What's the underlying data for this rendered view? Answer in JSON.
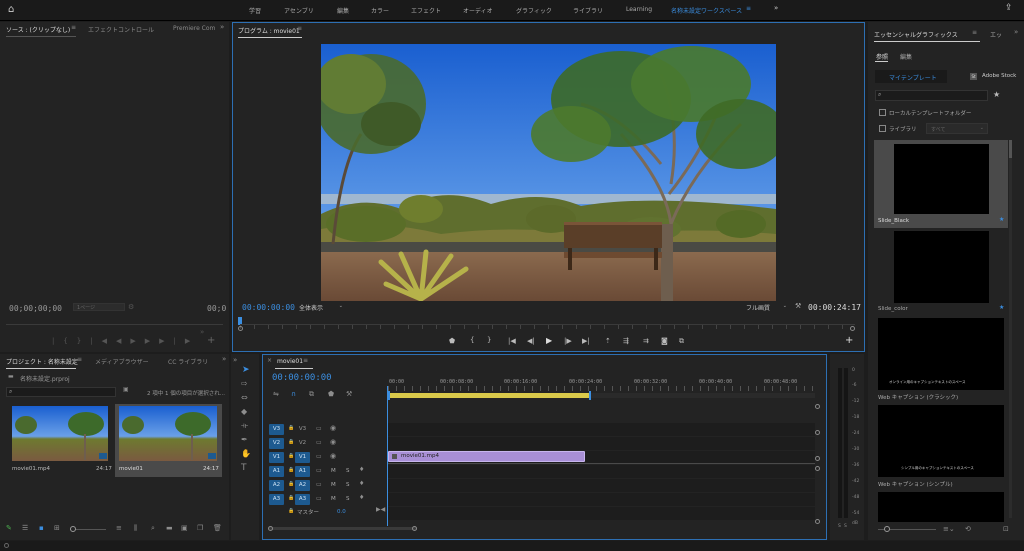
{
  "workspaces": [
    "学習",
    "アセンブリ",
    "編集",
    "カラー",
    "エフェクト",
    "オーディオ",
    "グラフィック",
    "ライブラリ",
    "Learning",
    "名称未設定ワークスペース"
  ],
  "source_panel": {
    "tabs": [
      "ソース : (クリップなし)",
      "エフェクトコントロール",
      "Premiere Com"
    ],
    "timecode_left": "00;00;00;00",
    "page": "1ページ",
    "timecode_right": "00;0"
  },
  "program_panel": {
    "title": "プログラム : movie01",
    "timecode_current": "00:00:00:00",
    "zoom": "全体表示",
    "quality": "フル画質",
    "duration": "00:00:24:17"
  },
  "project_panel": {
    "tabs": [
      "プロジェクト : 名称未設定",
      "メディアブラウザー",
      "CC ライブラリ"
    ],
    "file": "名称未設定.prproj",
    "selection_info": "2 項中 1 個の項目が選択され...",
    "items": [
      {
        "name": "movie01.mp4",
        "duration": "24:17"
      },
      {
        "name": "movie01",
        "duration": "24:17"
      }
    ]
  },
  "timeline": {
    "title": "movie01",
    "timecode": "00:00:00:00",
    "ruler": [
      "00:00",
      "00:00:08:00",
      "00:00:16:00",
      "00:00:24:00",
      "00:00:32:00",
      "00:00:40:00",
      "00:00:48:00"
    ],
    "video_tracks": [
      {
        "src": "V3",
        "name": "V3"
      },
      {
        "src": "V2",
        "name": "V2"
      },
      {
        "src": "V1",
        "name": "V1"
      }
    ],
    "audio_tracks": [
      {
        "src": "A1",
        "name": "A1",
        "m": "M",
        "s": "S"
      },
      {
        "src": "A2",
        "name": "A2",
        "m": "M",
        "s": "S"
      },
      {
        "src": "A3",
        "name": "A3",
        "m": "M",
        "s": "S"
      }
    ],
    "master_label": "マスター",
    "master_value": "0.0",
    "clip_label": "movie01.mp4"
  },
  "meters": [
    "0",
    "-6",
    "-12",
    "-18",
    "-24",
    "-30",
    "-36",
    "-42",
    "-48",
    "-54",
    "dB"
  ],
  "meter_foot": [
    "S",
    "S"
  ],
  "essential_graphics": {
    "title": "エッセンシャルグラフィックス",
    "title_overflow": "エッ",
    "tabs": [
      "参照",
      "編集"
    ],
    "sub_tabs": [
      "マイテンプレート",
      "Adobe Stock"
    ],
    "local_folder": "ローカルテンプレートフォルダー",
    "library": "ライブラリ",
    "library_select": "すべて",
    "templates": [
      {
        "name": "Slide_Black"
      },
      {
        "name": "Slide_color"
      },
      {
        "name": "Web キャプション (クラシック)",
        "caption": "オンライン用のキャプションテキストのスペース"
      },
      {
        "name": "Web キャプション (シンプル)",
        "caption": "シンプル用のキャプションテキストのスペース"
      }
    ]
  },
  "colors": {
    "accent": "#3b8ee0",
    "clip": "#a88fd6",
    "track_on": "#1d5a90"
  }
}
